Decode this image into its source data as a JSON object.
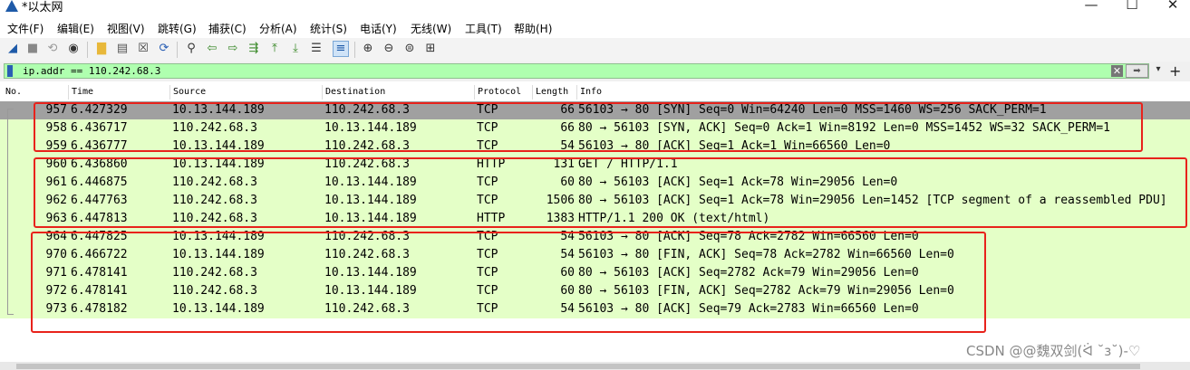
{
  "window": {
    "title": "*以太网",
    "minimize_glyph": "—",
    "maximize_glyph": "☐",
    "close_glyph": "✕"
  },
  "menu": [
    "文件(F)",
    "编辑(E)",
    "视图(V)",
    "跳转(G)",
    "捕获(C)",
    "分析(A)",
    "统计(S)",
    "电话(Y)",
    "无线(W)",
    "工具(T)",
    "帮助(H)"
  ],
  "toolbar": {
    "icons": [
      {
        "name": "shark-fin-start-icon",
        "glyph": "◢",
        "color": "#1e5aa8"
      },
      {
        "name": "stop-capture-icon",
        "glyph": "■",
        "color": "#888888"
      },
      {
        "name": "restart-capture-icon",
        "glyph": "⟲",
        "color": "#9a9a9a"
      },
      {
        "name": "capture-options-icon",
        "glyph": "◉",
        "color": "#333333"
      },
      {
        "name": "open-file-icon",
        "glyph": "▇",
        "color": "#e8b83a"
      },
      {
        "name": "save-file-icon",
        "glyph": "▤",
        "color": "#555555"
      },
      {
        "name": "close-file-icon",
        "glyph": "☒",
        "color": "#444444"
      },
      {
        "name": "reload-file-icon",
        "glyph": "⟳",
        "color": "#2a5fb4"
      },
      {
        "name": "find-packet-icon",
        "glyph": "⚲",
        "color": "#333333"
      },
      {
        "name": "go-back-icon",
        "glyph": "⇦",
        "color": "#3b8a2a"
      },
      {
        "name": "go-forward-icon",
        "glyph": "⇨",
        "color": "#3b8a2a"
      },
      {
        "name": "go-to-packet-icon",
        "glyph": "⇶",
        "color": "#3b8a2a"
      },
      {
        "name": "go-first-icon",
        "glyph": "⤒",
        "color": "#3b8a2a"
      },
      {
        "name": "go-last-icon",
        "glyph": "⤓",
        "color": "#3b8a2a"
      },
      {
        "name": "auto-scroll-icon",
        "glyph": "☰",
        "color": "#333333"
      },
      {
        "name": "colorize-icon",
        "glyph": "≡",
        "color": "#1e5aa8"
      },
      {
        "name": "zoom-in-icon",
        "glyph": "⊕",
        "color": "#333333"
      },
      {
        "name": "zoom-out-icon",
        "glyph": "⊖",
        "color": "#333333"
      },
      {
        "name": "zoom-normal-icon",
        "glyph": "⊜",
        "color": "#333333"
      },
      {
        "name": "resize-columns-icon",
        "glyph": "⊞",
        "color": "#333333"
      }
    ]
  },
  "filter": {
    "value": "ip.addr == 110.242.68.3",
    "clear_glyph": "✕",
    "apply_glyph": "➡",
    "expr_glyph": "▾",
    "plus_glyph": "+",
    "background_color": "#afffaf"
  },
  "columns": [
    "No.",
    "Time",
    "Source",
    "Destination",
    "Protocol",
    "Length",
    "Info"
  ],
  "packets": [
    {
      "no": "957",
      "time": "6.427329",
      "src": "10.13.144.189",
      "dst": "110.242.68.3",
      "proto": "TCP",
      "len": "66",
      "info": "56103 → 80 [SYN] Seq=0 Win=64240 Len=0 MSS=1460 WS=256 SACK_PERM=1"
    },
    {
      "no": "958",
      "time": "6.436717",
      "src": "110.242.68.3",
      "dst": "10.13.144.189",
      "proto": "TCP",
      "len": "66",
      "info": "80 → 56103 [SYN, ACK] Seq=0 Ack=1 Win=8192 Len=0 MSS=1452 WS=32 SACK_PERM=1"
    },
    {
      "no": "959",
      "time": "6.436777",
      "src": "10.13.144.189",
      "dst": "110.242.68.3",
      "proto": "TCP",
      "len": "54",
      "info": "56103 → 80 [ACK] Seq=1 Ack=1 Win=66560 Len=0"
    },
    {
      "no": "960",
      "time": "6.436860",
      "src": "10.13.144.189",
      "dst": "110.242.68.3",
      "proto": "HTTP",
      "len": "131",
      "info": "GET / HTTP/1.1"
    },
    {
      "no": "961",
      "time": "6.446875",
      "src": "110.242.68.3",
      "dst": "10.13.144.189",
      "proto": "TCP",
      "len": "60",
      "info": "80 → 56103 [ACK] Seq=1 Ack=78 Win=29056 Len=0"
    },
    {
      "no": "962",
      "time": "6.447763",
      "src": "110.242.68.3",
      "dst": "10.13.144.189",
      "proto": "TCP",
      "len": "1506",
      "info": "80 → 56103 [ACK] Seq=1 Ack=78 Win=29056 Len=1452 [TCP segment of a reassembled PDU]"
    },
    {
      "no": "963",
      "time": "6.447813",
      "src": "110.242.68.3",
      "dst": "10.13.144.189",
      "proto": "HTTP",
      "len": "1383",
      "info": "HTTP/1.1 200 OK  (text/html)"
    },
    {
      "no": "964",
      "time": "6.447825",
      "src": "10.13.144.189",
      "dst": "110.242.68.3",
      "proto": "TCP",
      "len": "54",
      "info": "56103 → 80 [ACK] Seq=78 Ack=2782 Win=66560 Len=0"
    },
    {
      "no": "970",
      "time": "6.466722",
      "src": "10.13.144.189",
      "dst": "110.242.68.3",
      "proto": "TCP",
      "len": "54",
      "info": "56103 → 80 [FIN, ACK] Seq=78 Ack=2782 Win=66560 Len=0"
    },
    {
      "no": "971",
      "time": "6.478141",
      "src": "110.242.68.3",
      "dst": "10.13.144.189",
      "proto": "TCP",
      "len": "60",
      "info": "80 → 56103 [ACK] Seq=2782 Ack=79 Win=29056 Len=0"
    },
    {
      "no": "972",
      "time": "6.478141",
      "src": "110.242.68.3",
      "dst": "10.13.144.189",
      "proto": "TCP",
      "len": "60",
      "info": "80 → 56103 [FIN, ACK] Seq=2782 Ack=79 Win=29056 Len=0"
    },
    {
      "no": "973",
      "time": "6.478182",
      "src": "10.13.144.189",
      "dst": "110.242.68.3",
      "proto": "TCP",
      "len": "54",
      "info": "56103 → 80 [ACK] Seq=79 Ack=2783 Win=66560 Len=0"
    }
  ],
  "row_colors": {
    "tcp_http": "#e4ffc7",
    "selected": "#a0a0a0"
  },
  "annotation_color": "#e8221b",
  "watermark": "CSDN @@魏双剑(ᐛ ˘з˘)-♡"
}
